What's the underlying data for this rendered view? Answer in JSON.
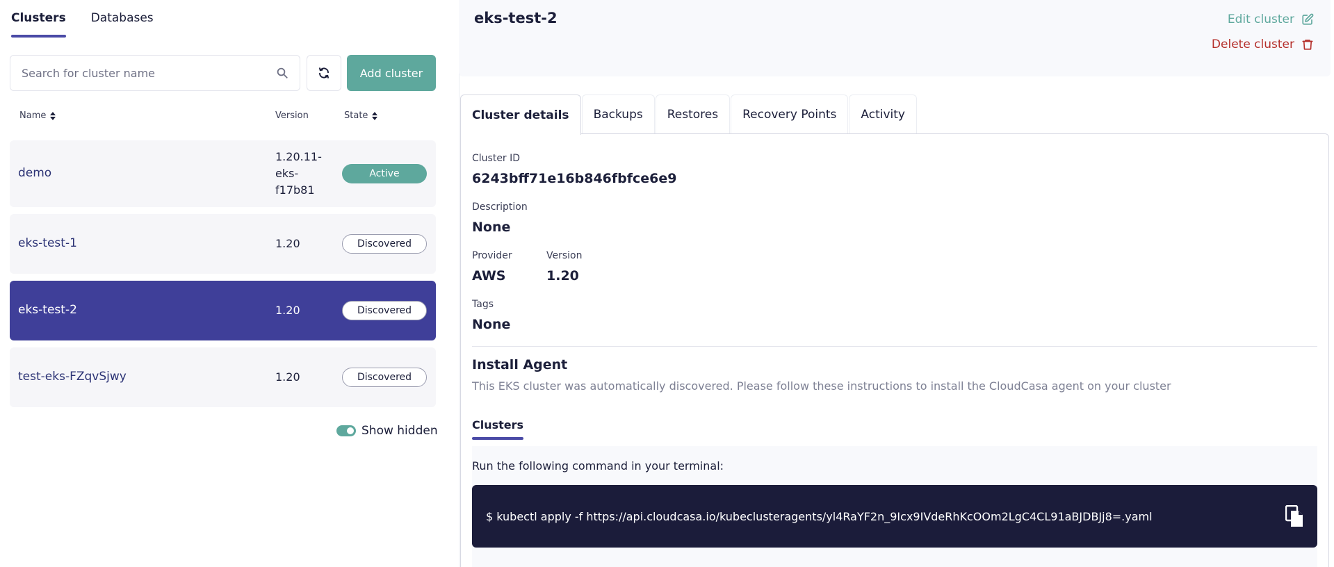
{
  "nav": {
    "tabs": [
      {
        "label": "Clusters",
        "active": true
      },
      {
        "label": "Databases",
        "active": false
      }
    ]
  },
  "search": {
    "placeholder": "Search for cluster name",
    "value": ""
  },
  "toolbar": {
    "add_label": "Add cluster"
  },
  "table": {
    "columns": {
      "name": "Name",
      "version": "Version",
      "state": "State"
    },
    "rows": [
      {
        "name": "demo",
        "version": "1.20.11-eks-f17b81",
        "state": "Active"
      },
      {
        "name": "eks-test-1",
        "version": "1.20",
        "state": "Discovered"
      },
      {
        "name": "eks-test-2",
        "version": "1.20",
        "state": "Discovered",
        "selected": true
      },
      {
        "name": "test-eks-FZqvSjwy",
        "version": "1.20",
        "state": "Discovered"
      }
    ]
  },
  "show_hidden": {
    "label": "Show hidden",
    "on": true
  },
  "detail": {
    "title": "eks-test-2",
    "edit_label": "Edit cluster",
    "delete_label": "Delete cluster",
    "tabs": [
      "Cluster details",
      "Backups",
      "Restores",
      "Recovery Points",
      "Activity"
    ],
    "active_tab": "Cluster details",
    "fields": {
      "cluster_id_label": "Cluster ID",
      "cluster_id": "6243bff71e16b846fbfce6e9",
      "description_label": "Description",
      "description": "None",
      "provider_label": "Provider",
      "provider": "AWS",
      "version_label": "Version",
      "version": "1.20",
      "tags_label": "Tags",
      "tags": "None"
    },
    "install": {
      "title": "Install Agent",
      "description": "This EKS cluster was automatically discovered. Please follow these instructions to install the CloudCasa agent on your cluster",
      "sub_tab": "Clusters",
      "run_text": "Run the following command in your terminal:",
      "command": "$ kubectl apply -f https://api.cloudcasa.io/kubeclusteragents/yl4RaYF2n_9Icx9IVdeRhKcOOm2LgC4CL91aBJDBJj8=.yaml"
    }
  },
  "colors": {
    "accent": "#4a4aa6",
    "selected_row": "#3f3f99",
    "teal": "#5ea89d",
    "danger": "#b5302b",
    "terminal": "#1b1c3a"
  }
}
